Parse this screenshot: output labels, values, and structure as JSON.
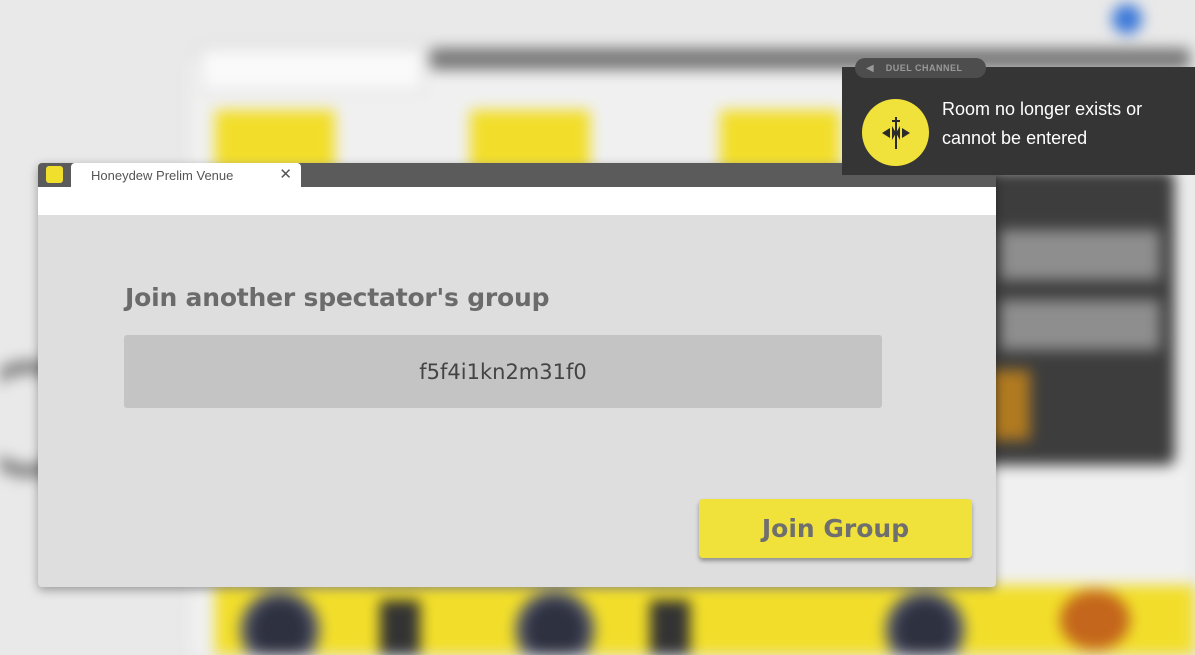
{
  "dialog": {
    "tab_title": "Honeydew Prelim Venue",
    "close_glyph": "✕",
    "heading": "Join another spectator's group",
    "group_code": "f5f4i1kn2m31f0",
    "join_button_label": "Join Group"
  },
  "notification": {
    "channel_label": "DUEL CHANNEL",
    "channel_icon": "megaphone-icon",
    "status_icon": "duel-vs-icon",
    "message_line1": "Room no longer exists or",
    "message_line2": "cannot be entered"
  },
  "colors": {
    "accent_yellow": "#f0e23a",
    "notification_bg": "#353535",
    "dialog_bg": "#dedede",
    "field_bg": "#c4c4c4"
  }
}
